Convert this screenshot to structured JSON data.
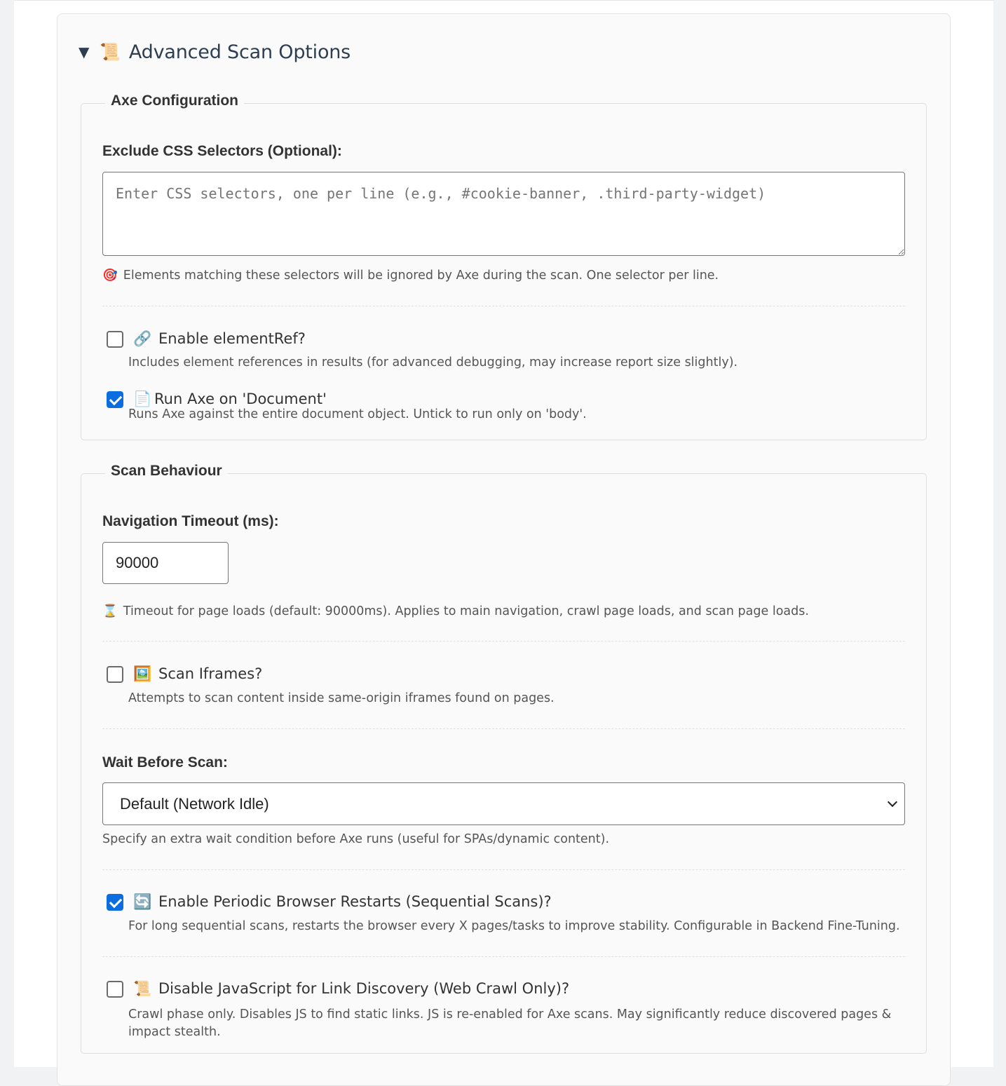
{
  "section": {
    "toggle_icon": "▼",
    "icon": "📜",
    "title": "Advanced Scan Options"
  },
  "axe_config": {
    "legend": "Axe Configuration",
    "exclude_label": "Exclude CSS Selectors (Optional):",
    "exclude_placeholder": "Enter CSS selectors, one per line (e.g., #cookie-banner, .third-party-widget)",
    "exclude_help_icon": "🎯",
    "exclude_help": "Elements matching these selectors will be ignored by Axe during the scan. One selector per line.",
    "element_ref": {
      "checked": false,
      "icon": "🔗",
      "label": "Enable elementRef?",
      "description": "Includes element references in results (for advanced debugging, may increase report size slightly)."
    },
    "run_on_document": {
      "checked": true,
      "icon": "📄",
      "label": "Run Axe on 'Document'",
      "description": "Runs Axe against the entire document object. Untick to run only on 'body'."
    }
  },
  "scan_behaviour": {
    "legend": "Scan Behaviour",
    "timeout_label": "Navigation Timeout (ms):",
    "timeout_value": "90000",
    "timeout_help_icon": "⌛",
    "timeout_help": "Timeout for page loads (default: 90000ms). Applies to main navigation, crawl page loads, and scan page loads.",
    "scan_iframes": {
      "checked": false,
      "icon": "🖼️",
      "label": "Scan Iframes?",
      "description": "Attempts to scan content inside same-origin iframes found on pages."
    },
    "wait_label": "Wait Before Scan:",
    "wait_selected": "Default (Network Idle)",
    "wait_help": "Specify an extra wait condition before Axe runs (useful for SPAs/dynamic content).",
    "periodic_restarts": {
      "checked": true,
      "icon": "🔄",
      "label": "Enable Periodic Browser Restarts (Sequential Scans)?",
      "description": "For long sequential scans, restarts the browser every X pages/tasks to improve stability. Configurable in Backend Fine-Tuning."
    },
    "disable_js": {
      "checked": false,
      "icon": "📜",
      "label": "Disable JavaScript for Link Discovery (Web Crawl Only)?",
      "description": "Crawl phase only. Disables JS to find static links. JS is re-enabled for Axe scans. May significantly reduce discovered pages & impact stealth."
    }
  }
}
